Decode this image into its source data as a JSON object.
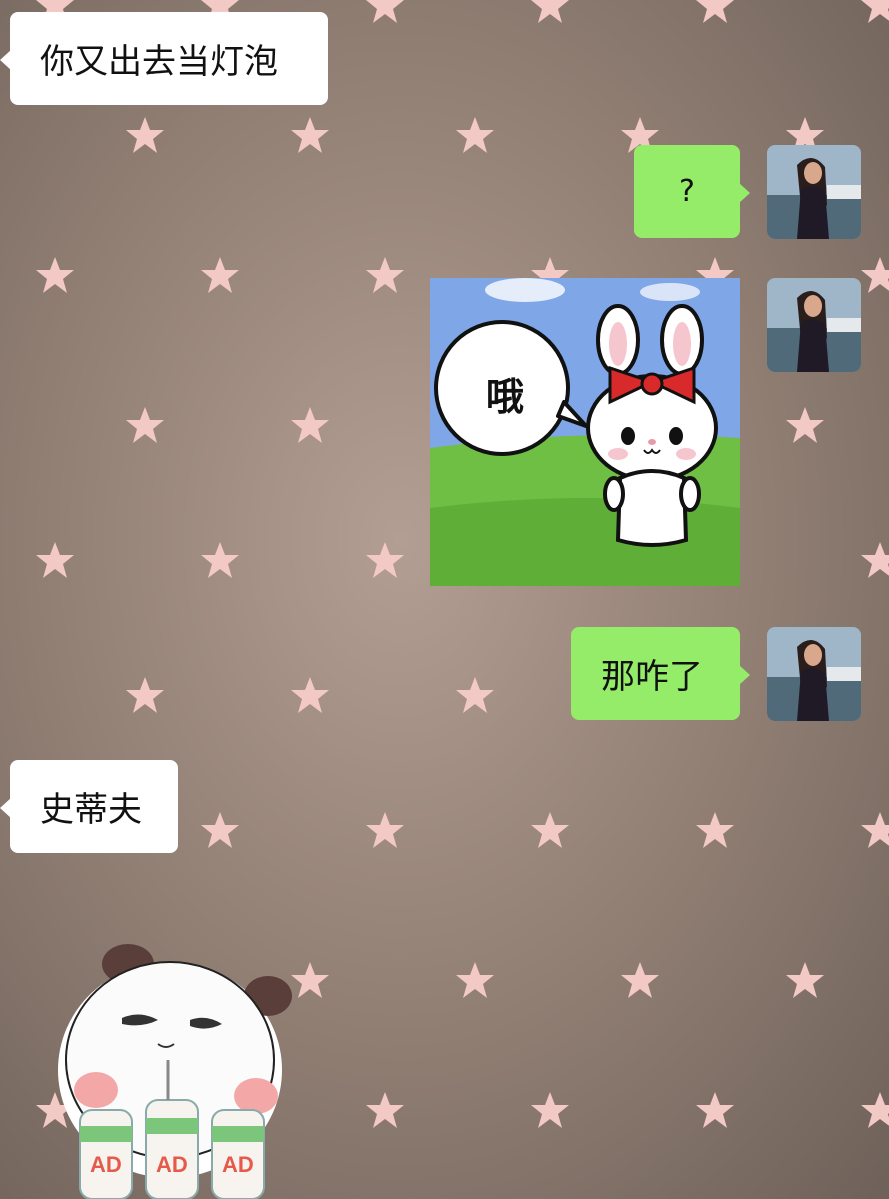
{
  "chat": {
    "messages": [
      {
        "side": "in",
        "type": "text",
        "text": "你又出去当灯泡"
      },
      {
        "side": "out",
        "type": "text",
        "text": "?"
      },
      {
        "side": "out",
        "type": "sticker",
        "sticker_name": "rabbit-sticker",
        "caption": "哦"
      },
      {
        "side": "out",
        "type": "text",
        "text": "那咋了"
      },
      {
        "side": "in",
        "type": "text",
        "text": "史蒂夫"
      },
      {
        "side": "in",
        "type": "sticker",
        "sticker_name": "panda-sticker",
        "bottle_label": "AD"
      }
    ]
  },
  "colors": {
    "incoming_bubble": "#ffffff",
    "outgoing_bubble": "#95ec69",
    "star": "#f2c9c4"
  },
  "icons": {
    "background_pattern": "star-icon"
  }
}
